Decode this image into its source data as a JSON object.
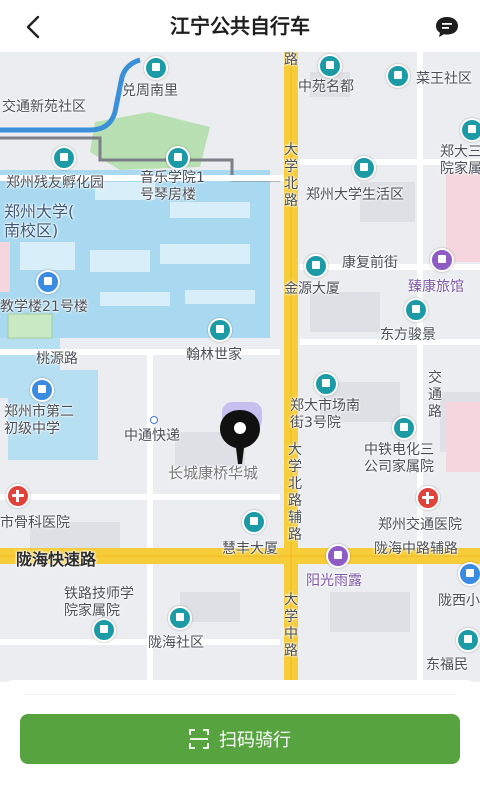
{
  "header": {
    "title": "江宁公共自行车"
  },
  "map": {
    "labels": {
      "l01": "交通新苑社区",
      "l02": "兑周南里",
      "l03": "中苑名都",
      "l04": "菜王社区",
      "l05": "郑州残友孵化园",
      "l06": "音乐学院1\n号琴房楼",
      "l07": "郑州大学生活区",
      "l08": "郑大三\n院家属",
      "l09": "郑州大学(\n南校区)",
      "l10": "康复前街",
      "l11": "臻康旅馆",
      "l12": "金源大厦",
      "l13": "教学楼21号楼",
      "l14": "东方骏景",
      "l15": "翰林世家",
      "l16": "桃源路",
      "l17": "郑大市场南\n街3号院",
      "l18": "交\n通\n路",
      "l19": "郑州市第二\n初级中学",
      "l20": "中通快递",
      "l21": "中铁电化三\n公司家属院",
      "l22": "长城康桥华城",
      "l23": "大\n学\n北\n路\n辅\n路",
      "l24": "市骨科医院",
      "l25": "郑州交通医院",
      "l26": "慧丰大厦",
      "l27": "陇海中路辅路",
      "l28": "陇海快速路",
      "l29": "阳光雨露",
      "l30": "铁路技师学\n院家属院",
      "l31": "陇西小",
      "l32": "陇海社区",
      "l33": "东福民",
      "l34": "大\n学\n北\n路",
      "l35": "大\n学\n中\n路",
      "l36": "路"
    }
  },
  "bottom": {
    "scan_button_label": "扫码骑行"
  },
  "icons": {
    "back": "chevron-left-icon",
    "chat": "chat-bubble-icon",
    "scan": "scan-frame-icon",
    "location": "location-pin-icon"
  },
  "colors": {
    "accent": "#56a33f",
    "road_yellow": "#f6c92e",
    "campus_blue": "#9ed3ee",
    "water": "#3a8fd9",
    "park_green": "#a7d7a4"
  }
}
